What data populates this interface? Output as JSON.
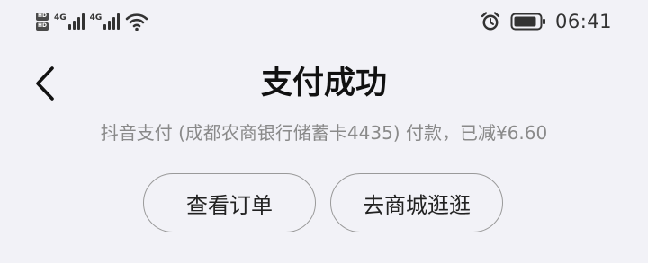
{
  "status_bar": {
    "hd_label": "HD",
    "network_1": "4G",
    "network_2": "4G",
    "time": "06:41",
    "icons": [
      "wifi-icon",
      "alarm-icon",
      "battery-icon"
    ]
  },
  "header": {
    "back_icon": "chevron-left-icon",
    "title": "支付成功"
  },
  "payment_info": "抖音支付 (成都农商银行储蓄卡4435) 付款，已减¥6.60",
  "actions": {
    "view_order_label": "查看订单",
    "shop_label": "去商城逛逛"
  },
  "colors": {
    "background": "#f2f2f7",
    "title": "#111111",
    "subtext": "#8a8a8a",
    "button_border": "#9a9a9a"
  }
}
